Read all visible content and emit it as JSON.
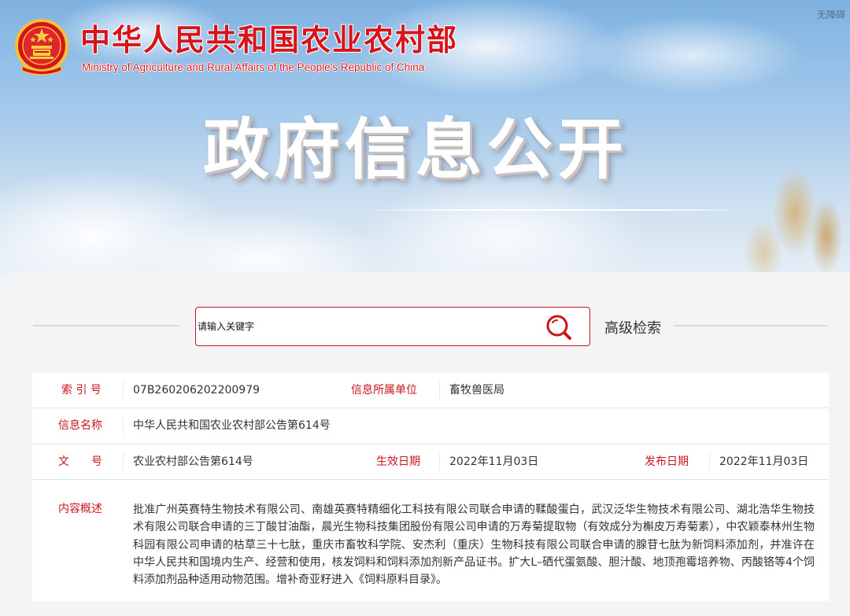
{
  "header": {
    "ministry_name_cn": "中华人民共和国农业农村部",
    "ministry_name_en": "Ministry of Agriculture and Rural Affairs of the People's Republic of China",
    "accessibility_link": "无障碍",
    "banner_title": "政府信息公开",
    "emblem_icon": "national-emblem-icon",
    "colors": {
      "brand_red": "#d8141b",
      "label_red": "#c8161d"
    }
  },
  "search": {
    "placeholder": "请输入关键字",
    "button_icon": "search-icon",
    "advanced_label": "高级检索"
  },
  "info": {
    "index_label": "索 引 号",
    "index_value": "07B260206202200979",
    "unit_label": "信息所属单位",
    "unit_value": "畜牧兽医局",
    "name_label": "信息名称",
    "name_value": "中华人民共和国农业农村部公告第614号",
    "doc_label": "文　　号",
    "doc_value": "农业农村部公告第614号",
    "effective_label": "生效日期",
    "effective_value": "2022年11月03日",
    "publish_label": "发布日期",
    "publish_value": "2022年11月03日",
    "summary_label": "内容概述",
    "summary_value": "批准广州英赛特生物技术有限公司、南雄英赛特精细化工科技有限公司联合申请的鞣酸蛋白，武汉泛华生物技术有限公司、湖北浩华生物技术有限公司联合申请的三丁酸甘油酯，晨光生物科技集团股份有限公司申请的万寿菊提取物（有效成分为槲皮万寿菊素），中农颖泰林州生物科园有限公司申请的枯草三十七肽，重庆市畜牧科学院、安杰利（重庆）生物科技有限公司联合申请的腺苷七肽为新饲料添加剂，并准许在中华人民共和国境内生产、经营和使用，核发饲料和饲料添加剂新产品证书。扩大L–硒代蛋氨酸、胆汁酸、地顶孢霉培养物、丙酸铬等4个饲料添加剂品种适用动物范围。增补奇亚籽进入《饲料原料目录》。"
  }
}
